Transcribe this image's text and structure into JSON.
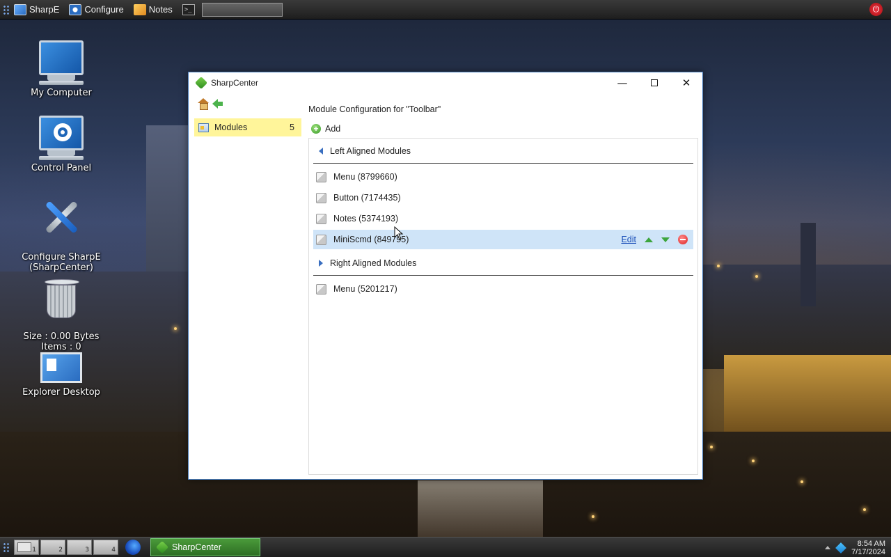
{
  "topbar": {
    "items": [
      {
        "label": "SharpE",
        "icon": "monitor-icon"
      },
      {
        "label": "Configure",
        "icon": "monitor-gear-icon"
      },
      {
        "label": "Notes",
        "icon": "notes-icon"
      }
    ],
    "terminal_icon": ">_",
    "input_value": "",
    "power_icon": "power-icon"
  },
  "desktop": {
    "icons": [
      {
        "label": "My Computer"
      },
      {
        "label": "Control Panel"
      },
      {
        "label": "Configure SharpE\n(SharpCenter)"
      },
      {
        "label": "Size : 0.00 Bytes\nItems : 0"
      },
      {
        "label": "Explorer Desktop"
      }
    ]
  },
  "window": {
    "title": "SharpCenter",
    "controls": {
      "minimize": "—",
      "maximize": "",
      "close": "✕"
    },
    "sidebar": {
      "items": [
        {
          "label": "Modules",
          "count": "5",
          "selected": true
        }
      ]
    },
    "main": {
      "heading": "Module Configuration for \"Toolbar\"",
      "add_label": "Add",
      "sections": [
        {
          "title": "Left Aligned Modules",
          "modules": [
            {
              "name": "Menu (8799660)"
            },
            {
              "name": "Button (7174435)"
            },
            {
              "name": "Notes (5374193)"
            },
            {
              "name": "MiniScmd (849795)",
              "selected": true,
              "actions": {
                "edit": "Edit"
              }
            }
          ]
        },
        {
          "title": "Right Aligned Modules",
          "modules": [
            {
              "name": "Menu (5201217)"
            }
          ]
        }
      ]
    }
  },
  "taskbar": {
    "workspaces": [
      "1",
      "2",
      "3",
      "4"
    ],
    "active_workspace": "1",
    "task": "SharpCenter",
    "clock_time": "8:54 AM",
    "clock_date": "7/17/2024"
  },
  "colors": {
    "selected_module_bg": "#cfe4f8",
    "sidebar_selected_bg": "#fff59a",
    "task_button": "#3d8a30",
    "link": "#1a4fb8"
  }
}
